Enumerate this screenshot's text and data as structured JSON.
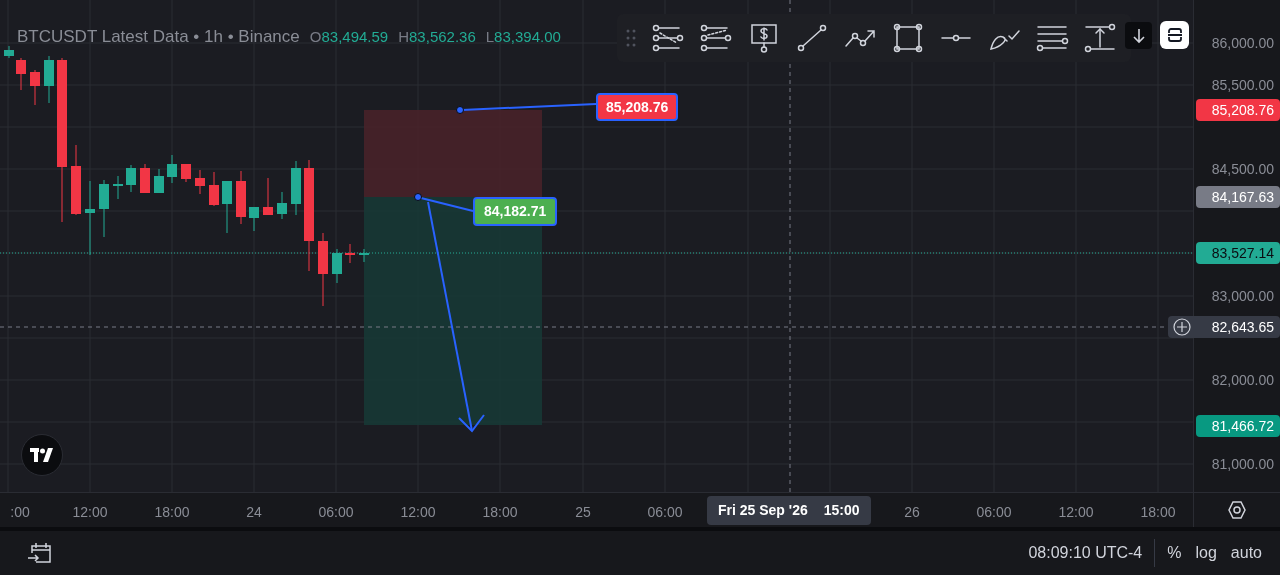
{
  "legend": {
    "title": "BTCUSDT Latest Data • 1h • Binance",
    "ohlc": [
      {
        "label": "O",
        "value": "83,494.59"
      },
      {
        "label": "H",
        "value": "83,562.36"
      },
      {
        "label": "L",
        "value": "83,394.00"
      }
    ]
  },
  "price_axis": {
    "ticks": [
      "86,000.00",
      "85,500.00",
      "84,500.00",
      "83,000.00",
      "82,000.00",
      "81,000.00"
    ]
  },
  "price_tags": [
    {
      "kind": "level",
      "value": "85,208.76",
      "color": "#f23645"
    },
    {
      "kind": "level",
      "value": "84,167.63",
      "color": "#787b86"
    },
    {
      "kind": "last",
      "value": "83,527.14",
      "color": "#22ab94"
    },
    {
      "kind": "crosshair",
      "value": "82,643.65",
      "color": "#363a45"
    },
    {
      "kind": "level",
      "value": "81,466.72",
      "color": "#089981"
    }
  ],
  "position": {
    "target_label": "85,208.76",
    "entry_label": "84,182.71"
  },
  "time_axis": {
    "ticks": [
      ":00",
      "12:00",
      "18:00",
      "24",
      "06:00",
      "12:00",
      "18:00",
      "25",
      "06:00",
      "26",
      "06:00",
      "12:00",
      "18:00"
    ],
    "crosshair_date": "Fri 25 Sep '26",
    "crosshair_time": "15:00"
  },
  "status_bar": {
    "time": "08:09:10 UTC-4",
    "buttons": [
      "%",
      "log",
      "auto"
    ]
  }
}
